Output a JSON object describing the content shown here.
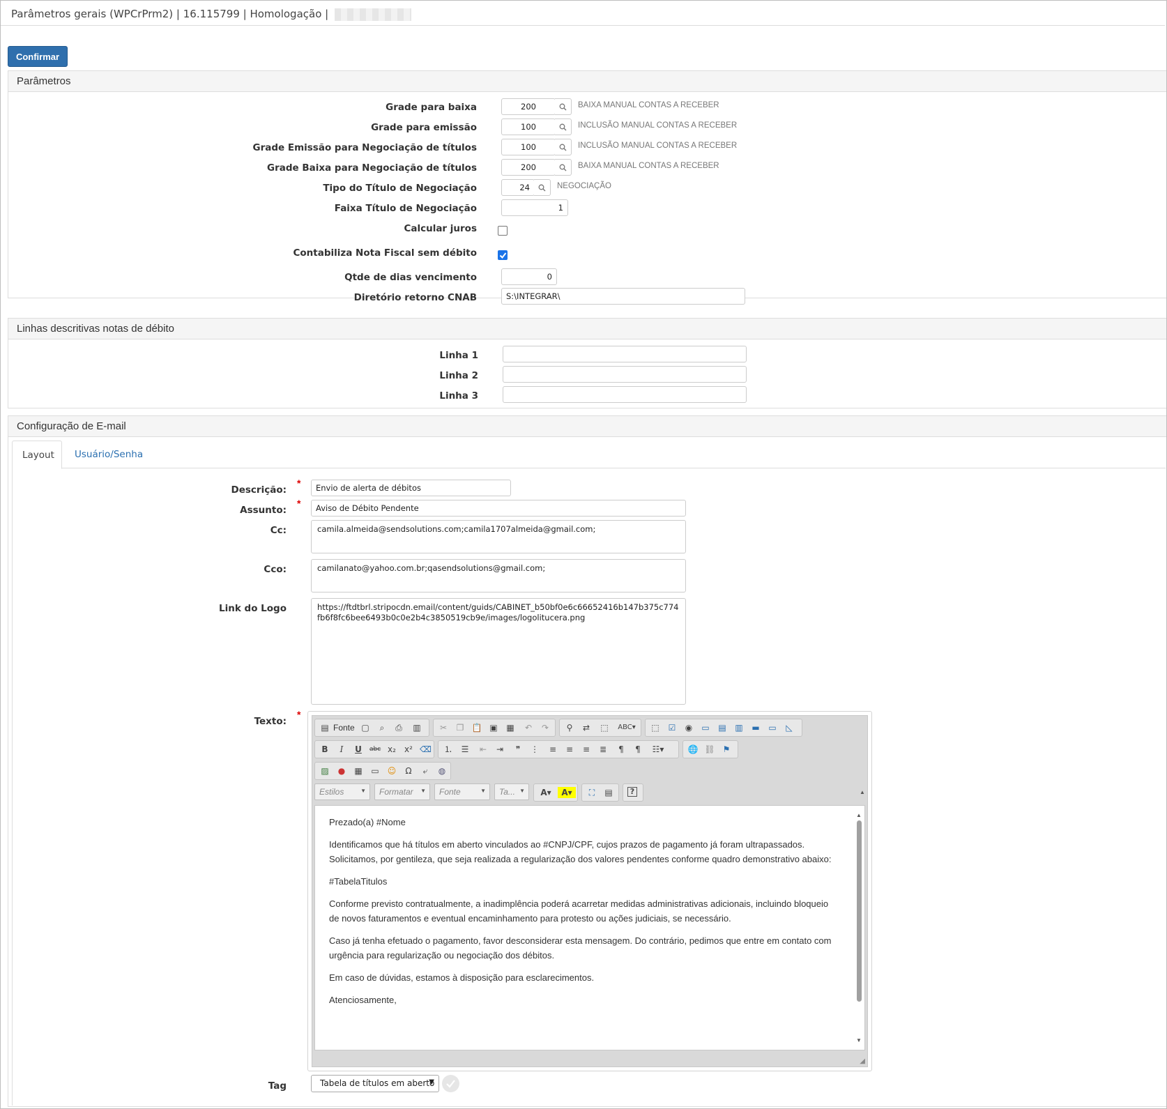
{
  "window": {
    "title": "Parâmetros gerais (WPCrPrm2) | 16.115799 | Homologação |"
  },
  "toolbar": {
    "confirm_label": "Confirmar"
  },
  "parametros": {
    "title": "Parâmetros",
    "grade_baixa": {
      "label": "Grade para baixa",
      "value": "200",
      "hint": "BAIXA MANUAL CONTAS A RECEBER"
    },
    "grade_emissao": {
      "label": "Grade para emissão",
      "value": "100",
      "hint": "INCLUSÃO MANUAL CONTAS A RECEBER"
    },
    "grade_emissao_neg": {
      "label": "Grade Emissão para Negociação de títulos",
      "value": "100",
      "hint": "INCLUSÃO MANUAL CONTAS A RECEBER"
    },
    "grade_baixa_neg": {
      "label": "Grade Baixa para Negociação de títulos",
      "value": "200",
      "hint": "BAIXA MANUAL CONTAS A RECEBER"
    },
    "tipo_titulo": {
      "label": "Tipo do Título de Negociação",
      "value": "24",
      "hint": "NEGOCIAÇÃO"
    },
    "faixa_titulo": {
      "label": "Faixa Título de Negociação",
      "value": "1"
    },
    "calcular_juros": {
      "label": "Calcular juros",
      "checked": false
    },
    "contabiliza_nf": {
      "label": "Contabiliza Nota Fiscal sem débito",
      "checked": true
    },
    "qtde_dias": {
      "label": "Qtde de dias vencimento",
      "value": "0"
    },
    "diretorio_cnab": {
      "label": "Diretório retorno CNAB",
      "value": "S:\\INTEGRAR\\"
    }
  },
  "linhas": {
    "title": "Linhas descritivas notas de débito",
    "linha1": {
      "label": "Linha 1",
      "value": ""
    },
    "linha2": {
      "label": "Linha 2",
      "value": ""
    },
    "linha3": {
      "label": "Linha 3",
      "value": ""
    }
  },
  "email": {
    "title": "Configuração de E-mail",
    "tabs": [
      {
        "label": "Layout"
      },
      {
        "label": "Usuário/Senha"
      }
    ],
    "descricao": {
      "label": "Descrição:",
      "value": "Envio de alerta de débitos"
    },
    "assunto": {
      "label": "Assunto:",
      "value": "Aviso de Débito Pendente"
    },
    "cc": {
      "label": "Cc:",
      "value": "camila.almeida@sendsolutions.com;camila1707almeida@gmail.com;"
    },
    "cco": {
      "label": "Cco:",
      "value": "camilanato@yahoo.com.br;qasendsolutions@gmail.com;"
    },
    "logo": {
      "label": "Link do Logo",
      "value": "https://ftdtbrl.stripocdn.email/content/guids/CABINET_b50bf0e6c66652416b147b375c774fb6f8fc6bee6493b0c0e2b4c3850519cb9e/images/logolitucera.png"
    },
    "texto": {
      "label": "Texto:",
      "toolbar": {
        "source_label": "Fonte",
        "styles": "Estilos",
        "format": "Formatar",
        "font": "Fonte",
        "size": "Ta..."
      },
      "paragraphs": [
        "Prezado(a) #Nome",
        "Identificamos que há títulos em aberto vinculados ao #CNPJ/CPF, cujos prazos de pagamento já foram ultrapassados. Solicitamos, por gentileza, que seja realizada a regularização dos valores pendentes conforme quadro demonstrativo abaixo:",
        "#TabelaTitulos",
        "Conforme previsto contratualmente, a inadimplência poderá acarretar medidas administrativas adicionais, incluindo bloqueio de novos faturamentos e eventual encaminhamento para protesto ou ações judiciais, se necessário.",
        "Caso já tenha efetuado o pagamento, favor desconsiderar esta mensagem. Do contrário, pedimos que entre em contato com urgência para regularização ou negociação dos débitos.",
        "Em caso de dúvidas, estamos à disposição para esclarecimentos.",
        "Atenciosamente,"
      ]
    },
    "tag": {
      "label": "Tag",
      "value": "Tabela de títulos em aberto"
    }
  },
  "colors": {
    "accent": "#2f6fad",
    "link": "#2a6fb0",
    "required": "#dd0000",
    "checkbox": "#1a73e8"
  }
}
